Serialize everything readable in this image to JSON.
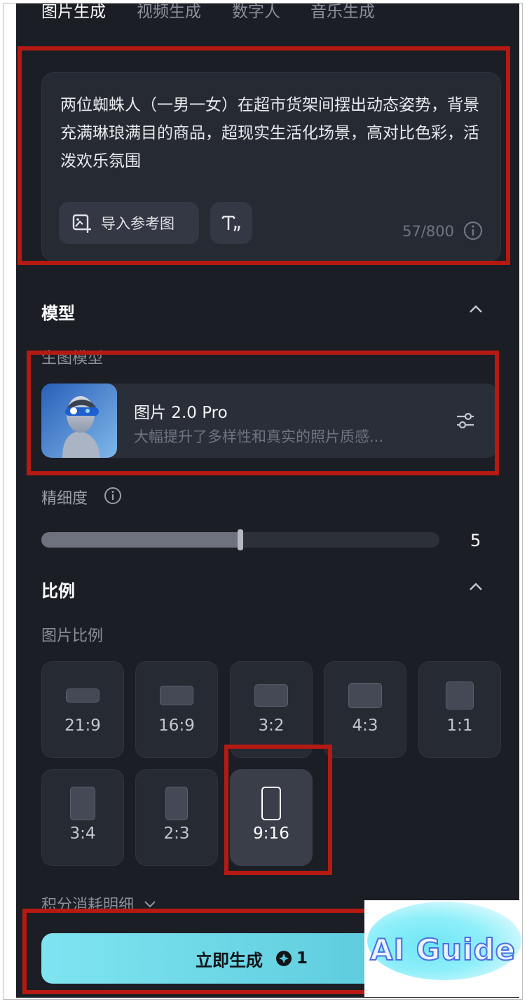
{
  "tabs": [
    {
      "label": "图片生成",
      "active": true
    },
    {
      "label": "视频生成",
      "active": false
    },
    {
      "label": "数字人",
      "active": false
    },
    {
      "label": "音乐生成",
      "active": false
    }
  ],
  "prompt": {
    "text": "两位蜘蛛人（一男一女）在超市货架间摆出动态姿势，背景充满琳琅满目的商品，超现实生活化场景，高对比色彩，活泼欢乐氛围",
    "import_ref_label": "导入参考图",
    "char_count": "57/800"
  },
  "model_section": {
    "title": "模型",
    "sub_label": "生图模型",
    "model_name": "图片 2.0 Pro",
    "model_desc": "大幅提升了多样性和真实的照片质感...",
    "detail_label": "精细度",
    "detail_value": "5",
    "detail_fraction": 0.5
  },
  "ratio_section": {
    "title": "比例",
    "sub_label": "图片比例",
    "options": [
      "21:9",
      "16:9",
      "3:2",
      "4:3",
      "1:1",
      "3:4",
      "2:3",
      "9:16"
    ],
    "selected": "9:16"
  },
  "footer": {
    "cost_label": "积分消耗明细",
    "generate_label": "立即生成",
    "generate_cost": "1"
  },
  "watermark": {
    "text": "AI Guide"
  },
  "colors": {
    "background": "#1b1e25",
    "accent": "#55c6d9",
    "annotation": "#b51a12"
  }
}
